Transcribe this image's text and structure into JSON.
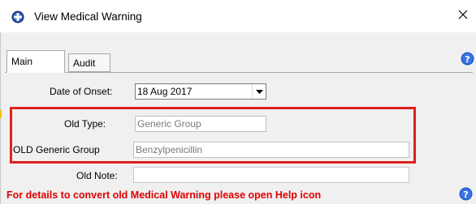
{
  "window": {
    "title": "View Medical Warning",
    "close_glyph": "✕",
    "icon": "app-medical-icon"
  },
  "tabs": [
    {
      "label": "Main",
      "selected": true
    },
    {
      "label": "Audit",
      "selected": false
    }
  ],
  "form": {
    "date_of_onset": {
      "label": "Date of Onset:",
      "value": "18 Aug 2017"
    },
    "old_type": {
      "label": "Old Type:",
      "value": "Generic Group"
    },
    "old_generic_group": {
      "label": "OLD Generic Group",
      "value": "Benzylpenicillin"
    },
    "old_note": {
      "label": "Old Note:",
      "value": ""
    }
  },
  "notice": "For details to convert old Medical Warning please open Help icon",
  "colors": {
    "highlight_border": "#e02020",
    "notice_text": "#e00000",
    "help_blue": "#1f56c8"
  }
}
